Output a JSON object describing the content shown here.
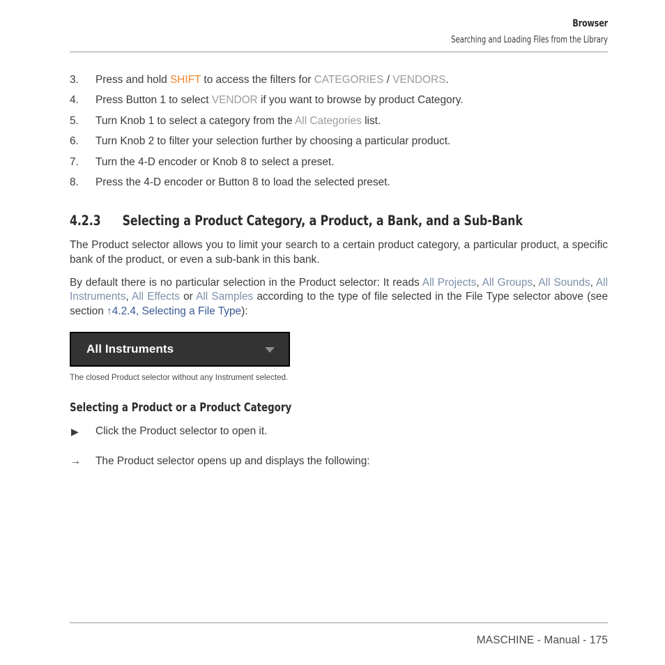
{
  "header": {
    "title": "Browser",
    "subtitle": "Searching and Loading Files from the Library"
  },
  "footer": {
    "text": "MASCHINE - Manual - 175"
  },
  "colors": {
    "accent_orange": "#f0862d",
    "ui_gray": "#9b9b9b",
    "ui_blue": "#7d90a9",
    "xref_blue": "#3a5a96",
    "widget_bg": "#333333",
    "widget_border": "#000000",
    "body_text": "#3b3b3b"
  },
  "steps": [
    {
      "num": "3.",
      "parts": [
        {
          "text": "Press and hold ",
          "style": "plain"
        },
        {
          "text": "SHIFT",
          "style": "shift"
        },
        {
          "text": " to access the filters for ",
          "style": "plain"
        },
        {
          "text": "CATEGORIES",
          "style": "ui-ref"
        },
        {
          "text": " / ",
          "style": "plain"
        },
        {
          "text": "VENDORS",
          "style": "ui-ref"
        },
        {
          "text": ".",
          "style": "plain"
        }
      ]
    },
    {
      "num": "4.",
      "parts": [
        {
          "text": "Press Button 1 to select ",
          "style": "plain"
        },
        {
          "text": "VENDOR",
          "style": "ui-ref"
        },
        {
          "text": " if you want to browse by product Category.",
          "style": "plain"
        }
      ]
    },
    {
      "num": "5.",
      "parts": [
        {
          "text": "Turn Knob 1 to select a category from the ",
          "style": "plain"
        },
        {
          "text": "All Categories",
          "style": "ui-ref"
        },
        {
          "text": " list.",
          "style": "plain"
        }
      ]
    },
    {
      "num": "6.",
      "parts": [
        {
          "text": "Turn Knob 2 to filter your selection further by choosing a particular product.",
          "style": "plain"
        }
      ]
    },
    {
      "num": "7.",
      "parts": [
        {
          "text": "Turn the 4-D encoder or Knob 8 to select a preset.",
          "style": "plain"
        }
      ]
    },
    {
      "num": "8.",
      "parts": [
        {
          "text": "Press the 4-D encoder or Button 8 to load the selected preset.",
          "style": "plain"
        }
      ]
    }
  ],
  "section": {
    "number": "4.2.3",
    "title": "Selecting a Product Category, a Product, a Bank, and a Sub-Bank"
  },
  "paragraph_1": "The Product selector allows you to limit your search to a certain product category, a particular product, a specific bank of the product, or even a sub-bank in this bank.",
  "paragraph_2": [
    {
      "text": "By default there is no particular selection in the Product selector: It reads ",
      "style": "plain"
    },
    {
      "text": "All Projects",
      "style": "ui-blue"
    },
    {
      "text": ", ",
      "style": "plain"
    },
    {
      "text": "All Groups",
      "style": "ui-blue"
    },
    {
      "text": ", ",
      "style": "plain"
    },
    {
      "text": "All Sounds",
      "style": "ui-blue"
    },
    {
      "text": ", ",
      "style": "plain"
    },
    {
      "text": "All Instruments",
      "style": "ui-blue"
    },
    {
      "text": ", ",
      "style": "plain"
    },
    {
      "text": "All Effects",
      "style": "ui-blue"
    },
    {
      "text": " or ",
      "style": "plain"
    },
    {
      "text": "All Samples",
      "style": "ui-blue"
    },
    {
      "text": " according to the type of file selected in the File Type selector above (see section ",
      "style": "plain"
    },
    {
      "text": "↑4.2.4, Selecting a File Type",
      "style": "xref"
    },
    {
      "text": "):",
      "style": "plain"
    }
  ],
  "product_selector": {
    "label": "All Instruments",
    "arrow_icon": "chevron-down-icon",
    "caption": "The closed Product selector without any Instrument selected."
  },
  "sub_heading": "Selecting a Product or a Product Category",
  "action": {
    "marker": "▶",
    "text": "Click the Product selector to open it."
  },
  "result": {
    "marker": "→",
    "text": "The Product selector opens up and displays the following:"
  }
}
